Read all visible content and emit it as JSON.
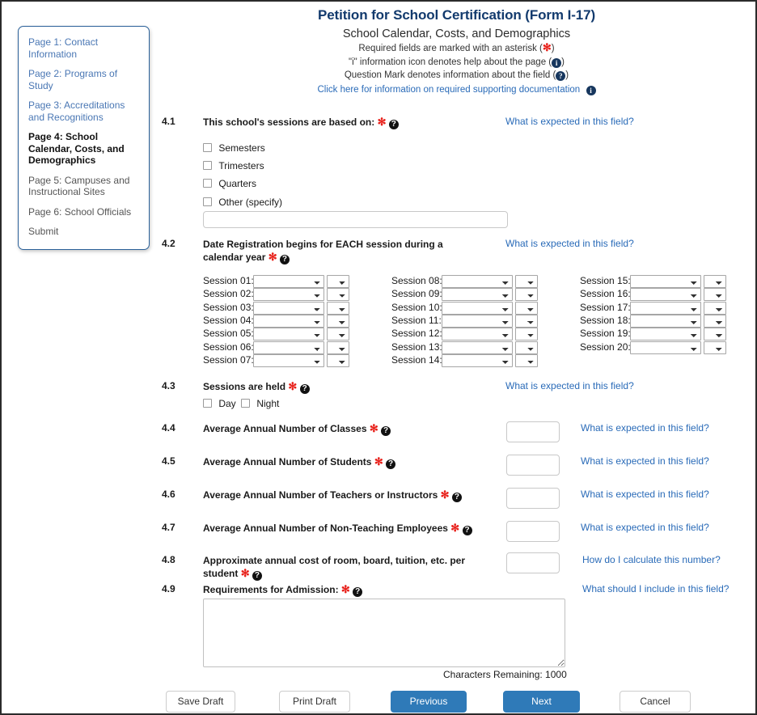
{
  "header": {
    "title": "Petition for School Certification (Form I-17)",
    "subtitle": "School Calendar, Costs, and Demographics",
    "note_required_pre": "Required fields are marked with an asterisk (",
    "note_required_post": ")",
    "note_info_pre": "\"i\" information icon denotes help about the page (",
    "note_info_post": ")",
    "note_question_pre": "Question Mark denotes information about the field (",
    "note_question_post": ")",
    "doc_link": "Click here for information on required supporting documentation"
  },
  "sidebar": {
    "items": [
      {
        "label": "Page 1: Contact Information",
        "state": "link"
      },
      {
        "label": "Page 2: Programs of Study",
        "state": "link"
      },
      {
        "label": "Page 3: Accreditations and Recognitions",
        "state": "link"
      },
      {
        "label": "Page 4: School Calendar, Costs, and Demographics",
        "state": "active"
      },
      {
        "label": "Page 5: Campuses and Instructional Sites",
        "state": "plain"
      },
      {
        "label": "Page 6: School Officials",
        "state": "plain"
      },
      {
        "label": "Submit",
        "state": "plain"
      }
    ]
  },
  "sections": {
    "s41": {
      "number": "4.1",
      "label": "This school's sessions are based on:",
      "hint": "What is expected in this field?",
      "options": [
        "Semesters",
        "Trimesters",
        "Quarters",
        "Other (specify)"
      ],
      "other_value": "",
      "other_placeholder": ""
    },
    "s42": {
      "number": "4.2",
      "label": "Date Registration begins for EACH session during a calendar year",
      "hint": "What is expected in this field?",
      "sessions": [
        "Session 01:",
        "Session 02:",
        "Session 03:",
        "Session 04:",
        "Session 05:",
        "Session 06:",
        "Session 07:",
        "Session 08:",
        "Session 09:",
        "Session 10:",
        "Session 11:",
        "Session 12:",
        "Session 13:",
        "Session 14:",
        "Session 15:",
        "Session 16:",
        "Session 17:",
        "Session 18:",
        "Session 19:",
        "Session 20:"
      ],
      "month_value": "",
      "day_value": ""
    },
    "s43": {
      "number": "4.3",
      "label": "Sessions are held",
      "hint": "What is expected in this field?",
      "options": [
        "Day",
        "Night"
      ]
    },
    "s44": {
      "number": "4.4",
      "label": "Average Annual Number of Classes",
      "hint": "What is expected in this field?",
      "value": ""
    },
    "s45": {
      "number": "4.5",
      "label": "Average Annual Number of Students",
      "hint": "What is expected in this field?",
      "value": ""
    },
    "s46": {
      "number": "4.6",
      "label": "Average Annual Number of Teachers or Instructors",
      "hint": "What is expected in this field?",
      "value": ""
    },
    "s47": {
      "number": "4.7",
      "label": "Average Annual Number of Non-Teaching Employees",
      "hint": "What is expected in this field?",
      "value": ""
    },
    "s48": {
      "number": "4.8",
      "label": "Approximate annual cost of room, board, tuition, etc. per student",
      "hint": "How do I calculate this number?",
      "value": ""
    },
    "s49": {
      "number": "4.9",
      "label": "Requirements for Admission:",
      "hint": "What should I include in this field?",
      "value": "",
      "chars_remaining": "Characters Remaining: 1000"
    }
  },
  "footer": {
    "save_draft": "Save Draft",
    "print_draft": "Print Draft",
    "previous": "Previous",
    "next": "Next",
    "cancel": "Cancel"
  },
  "colors": {
    "title_blue": "#123a6d",
    "link_blue": "#2a6bb8",
    "asterisk_red": "#e8201a",
    "info_navy": "#17375e",
    "primary_button": "#2f7ab8"
  },
  "icons": {
    "asterisk": "✻",
    "info": "i",
    "question": "?"
  }
}
